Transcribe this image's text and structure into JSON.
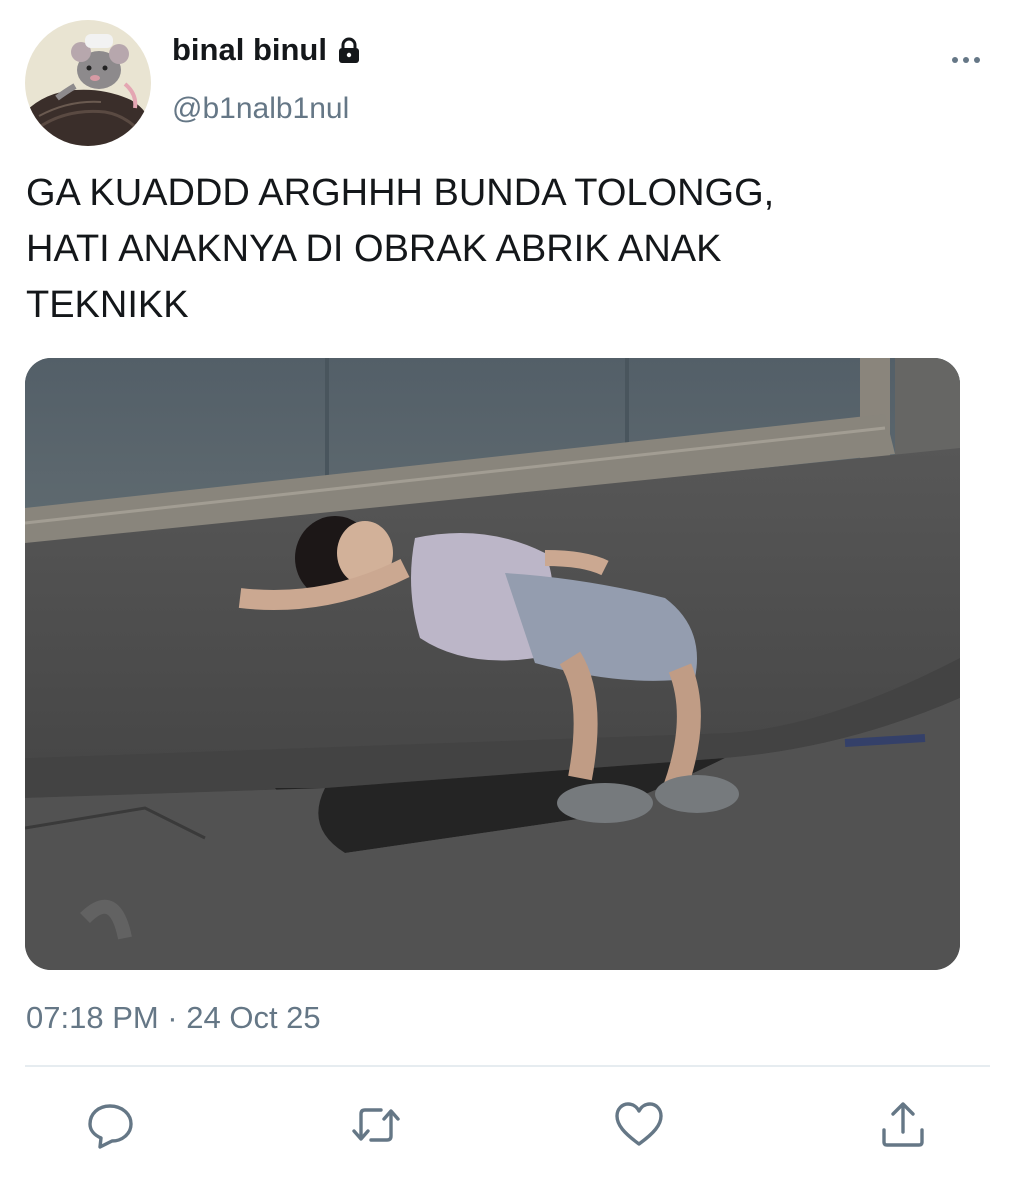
{
  "user": {
    "display_name": "binal binul",
    "handle": "@b1nalb1nul",
    "protected_icon": "lock-icon",
    "avatar_icon": "avatar"
  },
  "tweet": {
    "text_lines": [
      "GA KUADDD ARGHHH BUNDA TOLONGG,",
      "HATI ANAKNYA DI OBRAK ABRIK ANAK",
      "TEKNIKK"
    ],
    "timestamp": "07:18 PM · 24 Oct 25"
  },
  "actions": {
    "reply_icon": "reply-icon",
    "retweet_icon": "retweet-icon",
    "like_icon": "heart-icon",
    "share_icon": "share-icon",
    "more_icon": "more-icon"
  },
  "colors": {
    "text": "#14171a",
    "secondary": "#657786",
    "accent": "#1da1f2",
    "divider": "#e6ecf0"
  }
}
